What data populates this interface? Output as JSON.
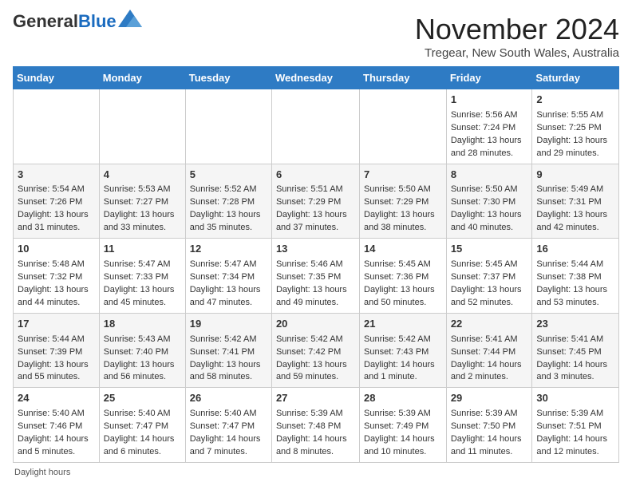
{
  "header": {
    "logo_general": "General",
    "logo_blue": "Blue",
    "month_title": "November 2024",
    "location": "Tregear, New South Wales, Australia"
  },
  "weekdays": [
    "Sunday",
    "Monday",
    "Tuesday",
    "Wednesday",
    "Thursday",
    "Friday",
    "Saturday"
  ],
  "weeks": [
    [
      {
        "day": "",
        "content": ""
      },
      {
        "day": "",
        "content": ""
      },
      {
        "day": "",
        "content": ""
      },
      {
        "day": "",
        "content": ""
      },
      {
        "day": "",
        "content": ""
      },
      {
        "day": "1",
        "content": "Sunrise: 5:56 AM\nSunset: 7:24 PM\nDaylight: 13 hours and 28 minutes."
      },
      {
        "day": "2",
        "content": "Sunrise: 5:55 AM\nSunset: 7:25 PM\nDaylight: 13 hours and 29 minutes."
      }
    ],
    [
      {
        "day": "3",
        "content": "Sunrise: 5:54 AM\nSunset: 7:26 PM\nDaylight: 13 hours and 31 minutes."
      },
      {
        "day": "4",
        "content": "Sunrise: 5:53 AM\nSunset: 7:27 PM\nDaylight: 13 hours and 33 minutes."
      },
      {
        "day": "5",
        "content": "Sunrise: 5:52 AM\nSunset: 7:28 PM\nDaylight: 13 hours and 35 minutes."
      },
      {
        "day": "6",
        "content": "Sunrise: 5:51 AM\nSunset: 7:29 PM\nDaylight: 13 hours and 37 minutes."
      },
      {
        "day": "7",
        "content": "Sunrise: 5:50 AM\nSunset: 7:29 PM\nDaylight: 13 hours and 38 minutes."
      },
      {
        "day": "8",
        "content": "Sunrise: 5:50 AM\nSunset: 7:30 PM\nDaylight: 13 hours and 40 minutes."
      },
      {
        "day": "9",
        "content": "Sunrise: 5:49 AM\nSunset: 7:31 PM\nDaylight: 13 hours and 42 minutes."
      }
    ],
    [
      {
        "day": "10",
        "content": "Sunrise: 5:48 AM\nSunset: 7:32 PM\nDaylight: 13 hours and 44 minutes."
      },
      {
        "day": "11",
        "content": "Sunrise: 5:47 AM\nSunset: 7:33 PM\nDaylight: 13 hours and 45 minutes."
      },
      {
        "day": "12",
        "content": "Sunrise: 5:47 AM\nSunset: 7:34 PM\nDaylight: 13 hours and 47 minutes."
      },
      {
        "day": "13",
        "content": "Sunrise: 5:46 AM\nSunset: 7:35 PM\nDaylight: 13 hours and 49 minutes."
      },
      {
        "day": "14",
        "content": "Sunrise: 5:45 AM\nSunset: 7:36 PM\nDaylight: 13 hours and 50 minutes."
      },
      {
        "day": "15",
        "content": "Sunrise: 5:45 AM\nSunset: 7:37 PM\nDaylight: 13 hours and 52 minutes."
      },
      {
        "day": "16",
        "content": "Sunrise: 5:44 AM\nSunset: 7:38 PM\nDaylight: 13 hours and 53 minutes."
      }
    ],
    [
      {
        "day": "17",
        "content": "Sunrise: 5:44 AM\nSunset: 7:39 PM\nDaylight: 13 hours and 55 minutes."
      },
      {
        "day": "18",
        "content": "Sunrise: 5:43 AM\nSunset: 7:40 PM\nDaylight: 13 hours and 56 minutes."
      },
      {
        "day": "19",
        "content": "Sunrise: 5:42 AM\nSunset: 7:41 PM\nDaylight: 13 hours and 58 minutes."
      },
      {
        "day": "20",
        "content": "Sunrise: 5:42 AM\nSunset: 7:42 PM\nDaylight: 13 hours and 59 minutes."
      },
      {
        "day": "21",
        "content": "Sunrise: 5:42 AM\nSunset: 7:43 PM\nDaylight: 14 hours and 1 minute."
      },
      {
        "day": "22",
        "content": "Sunrise: 5:41 AM\nSunset: 7:44 PM\nDaylight: 14 hours and 2 minutes."
      },
      {
        "day": "23",
        "content": "Sunrise: 5:41 AM\nSunset: 7:45 PM\nDaylight: 14 hours and 3 minutes."
      }
    ],
    [
      {
        "day": "24",
        "content": "Sunrise: 5:40 AM\nSunset: 7:46 PM\nDaylight: 14 hours and 5 minutes."
      },
      {
        "day": "25",
        "content": "Sunrise: 5:40 AM\nSunset: 7:47 PM\nDaylight: 14 hours and 6 minutes."
      },
      {
        "day": "26",
        "content": "Sunrise: 5:40 AM\nSunset: 7:47 PM\nDaylight: 14 hours and 7 minutes."
      },
      {
        "day": "27",
        "content": "Sunrise: 5:39 AM\nSunset: 7:48 PM\nDaylight: 14 hours and 8 minutes."
      },
      {
        "day": "28",
        "content": "Sunrise: 5:39 AM\nSunset: 7:49 PM\nDaylight: 14 hours and 10 minutes."
      },
      {
        "day": "29",
        "content": "Sunrise: 5:39 AM\nSunset: 7:50 PM\nDaylight: 14 hours and 11 minutes."
      },
      {
        "day": "30",
        "content": "Sunrise: 5:39 AM\nSunset: 7:51 PM\nDaylight: 14 hours and 12 minutes."
      }
    ]
  ],
  "footer": {
    "daylight_label": "Daylight hours"
  }
}
